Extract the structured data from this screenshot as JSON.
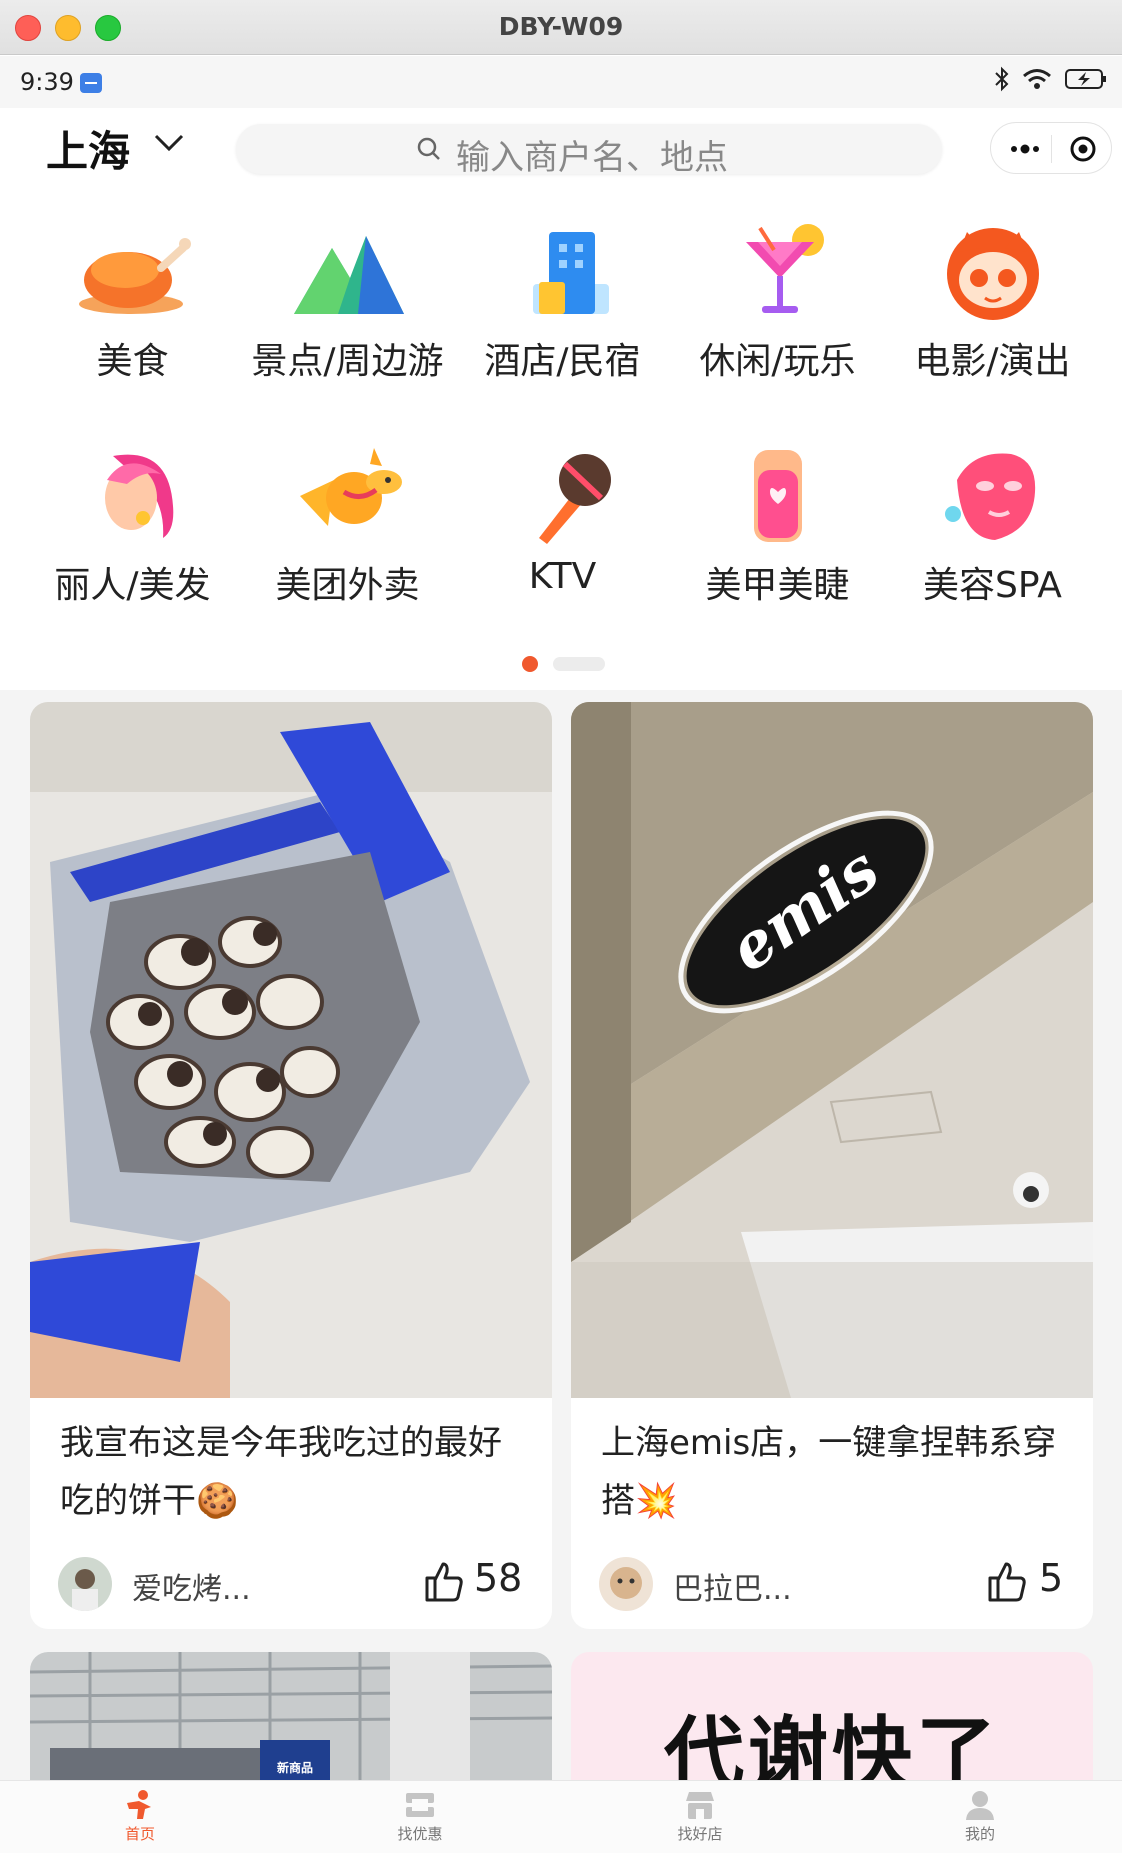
{
  "window": {
    "title": "DBY-W09"
  },
  "status_bar": {
    "time": "9:39"
  },
  "header": {
    "city": "上海",
    "search_placeholder": "输入商户名、地点"
  },
  "categories": [
    {
      "label": "美食",
      "icon": "roast-chicken-icon"
    },
    {
      "label": "景点/周边游",
      "icon": "mountain-icon"
    },
    {
      "label": "酒店/民宿",
      "icon": "hotel-building-icon"
    },
    {
      "label": "休闲/玩乐",
      "icon": "cocktail-icon"
    },
    {
      "label": "电影/演出",
      "icon": "cat-movie-icon"
    },
    {
      "label": "丽人/美发",
      "icon": "woman-hair-icon"
    },
    {
      "label": "美团外卖",
      "icon": "kangaroo-icon"
    },
    {
      "label": "KTV",
      "icon": "microphone-icon"
    },
    {
      "label": "美甲美睫",
      "icon": "nail-icon"
    },
    {
      "label": "美容SPA",
      "icon": "face-mask-icon"
    }
  ],
  "pager": {
    "pages": 2,
    "active": 1
  },
  "feed": [
    {
      "title": "我宣布这是今年我吃过的最好吃的饼干",
      "emoji": "🍪",
      "author": "爱吃烤...",
      "likes": "58"
    },
    {
      "title": "上海emis店，一键拿捏韩系穿搭",
      "emoji": "💥",
      "author": "巴拉巴...",
      "likes": "5",
      "sign_text": "emis"
    },
    {
      "title": "",
      "author": "",
      "likes": "",
      "sign_text": "新商品"
    },
    {
      "title": "",
      "author": "",
      "likes": "",
      "poster_text": "代谢快了"
    }
  ],
  "tabbar": {
    "items": [
      {
        "label": "首页",
        "icon": "home-person-icon",
        "active": true
      },
      {
        "label": "找优惠",
        "icon": "coupon-icon",
        "active": false
      },
      {
        "label": "找好店",
        "icon": "store-icon",
        "active": false
      },
      {
        "label": "我的",
        "icon": "profile-icon",
        "active": false
      }
    ]
  },
  "colors": {
    "accent": "#f0592e",
    "feed_bg": "#f4f4f4"
  }
}
